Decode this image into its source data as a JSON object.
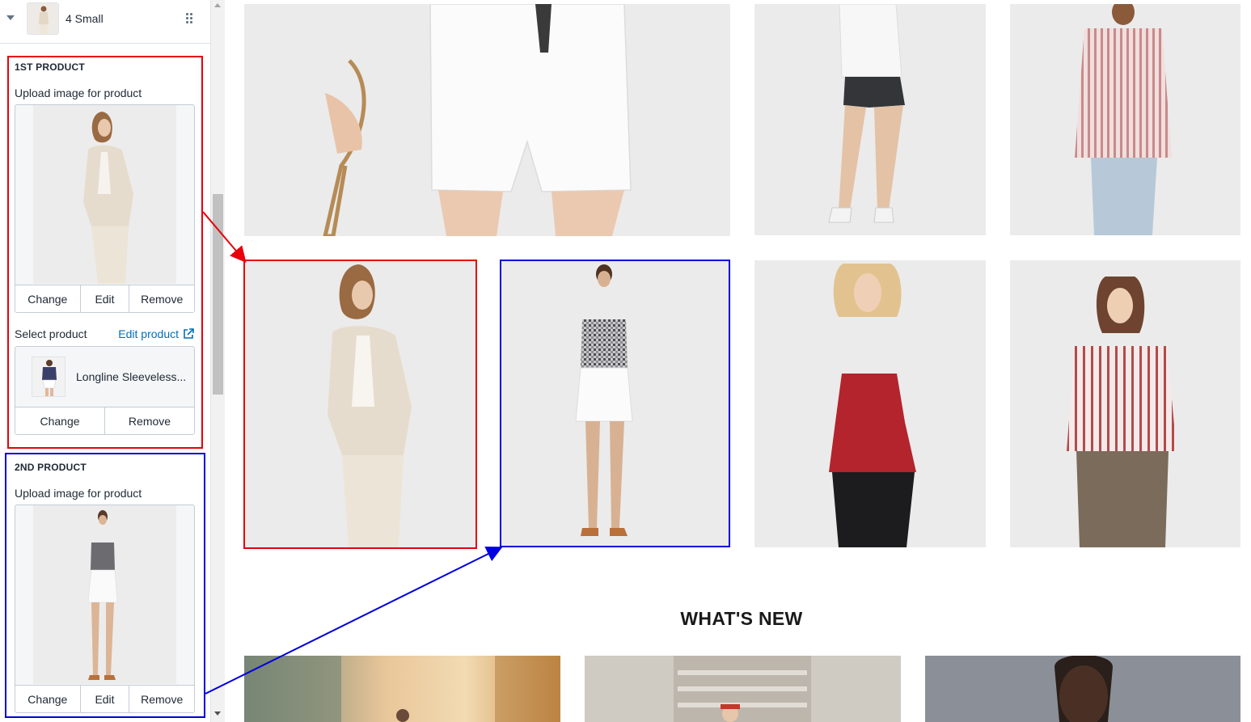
{
  "sidebar": {
    "header_title": "4 Small",
    "sections": [
      {
        "title": "1ST PRODUCT",
        "upload_label": "Upload image for product",
        "image_buttons": [
          "Change",
          "Edit",
          "Remove"
        ],
        "select_label": "Select product",
        "edit_product_link": "Edit product",
        "product_name": "Longline Sleeveless...",
        "product_buttons": [
          "Change",
          "Remove"
        ]
      },
      {
        "title": "2ND PRODUCT",
        "upload_label": "Upload image for product",
        "image_buttons": [
          "Change",
          "Edit",
          "Remove"
        ]
      }
    ]
  },
  "preview": {
    "section_heading": "WHAT'S NEW"
  },
  "colors": {
    "highlight_red": "#e8000b",
    "highlight_blue": "#0000e0",
    "link": "#006fbb"
  }
}
